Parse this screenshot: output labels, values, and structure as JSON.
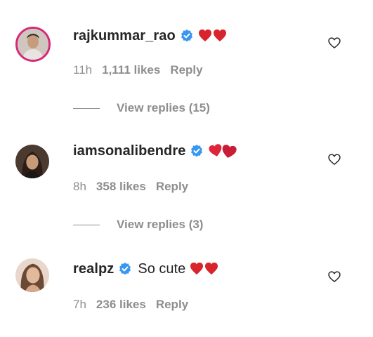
{
  "comments": [
    {
      "username": "rajkummar_rao",
      "text": "",
      "time": "11h",
      "likes": "1,111 likes",
      "reply": "Reply",
      "view_replies": "View replies (15)",
      "verified_icon": "verified-badge-icon",
      "like_icon": "heart-outline-icon",
      "emoji": "two red hearts"
    },
    {
      "username": "iamsonalibendre",
      "text": "",
      "time": "8h",
      "likes": "358 likes",
      "reply": "Reply",
      "view_replies": "View replies (3)",
      "verified_icon": "verified-badge-icon",
      "like_icon": "heart-outline-icon",
      "emoji": "two hearts"
    },
    {
      "username": "realpz",
      "text": "So cute",
      "time": "7h",
      "likes": "236 likes",
      "reply": "Reply",
      "verified_icon": "verified-badge-icon",
      "like_icon": "heart-outline-icon",
      "emoji": "two red hearts"
    }
  ],
  "colors": {
    "verified": "#3897f0",
    "heart": "#d8242c",
    "meta_text": "#8e8e8e",
    "username": "#262626",
    "story_ring": "#d62976"
  }
}
